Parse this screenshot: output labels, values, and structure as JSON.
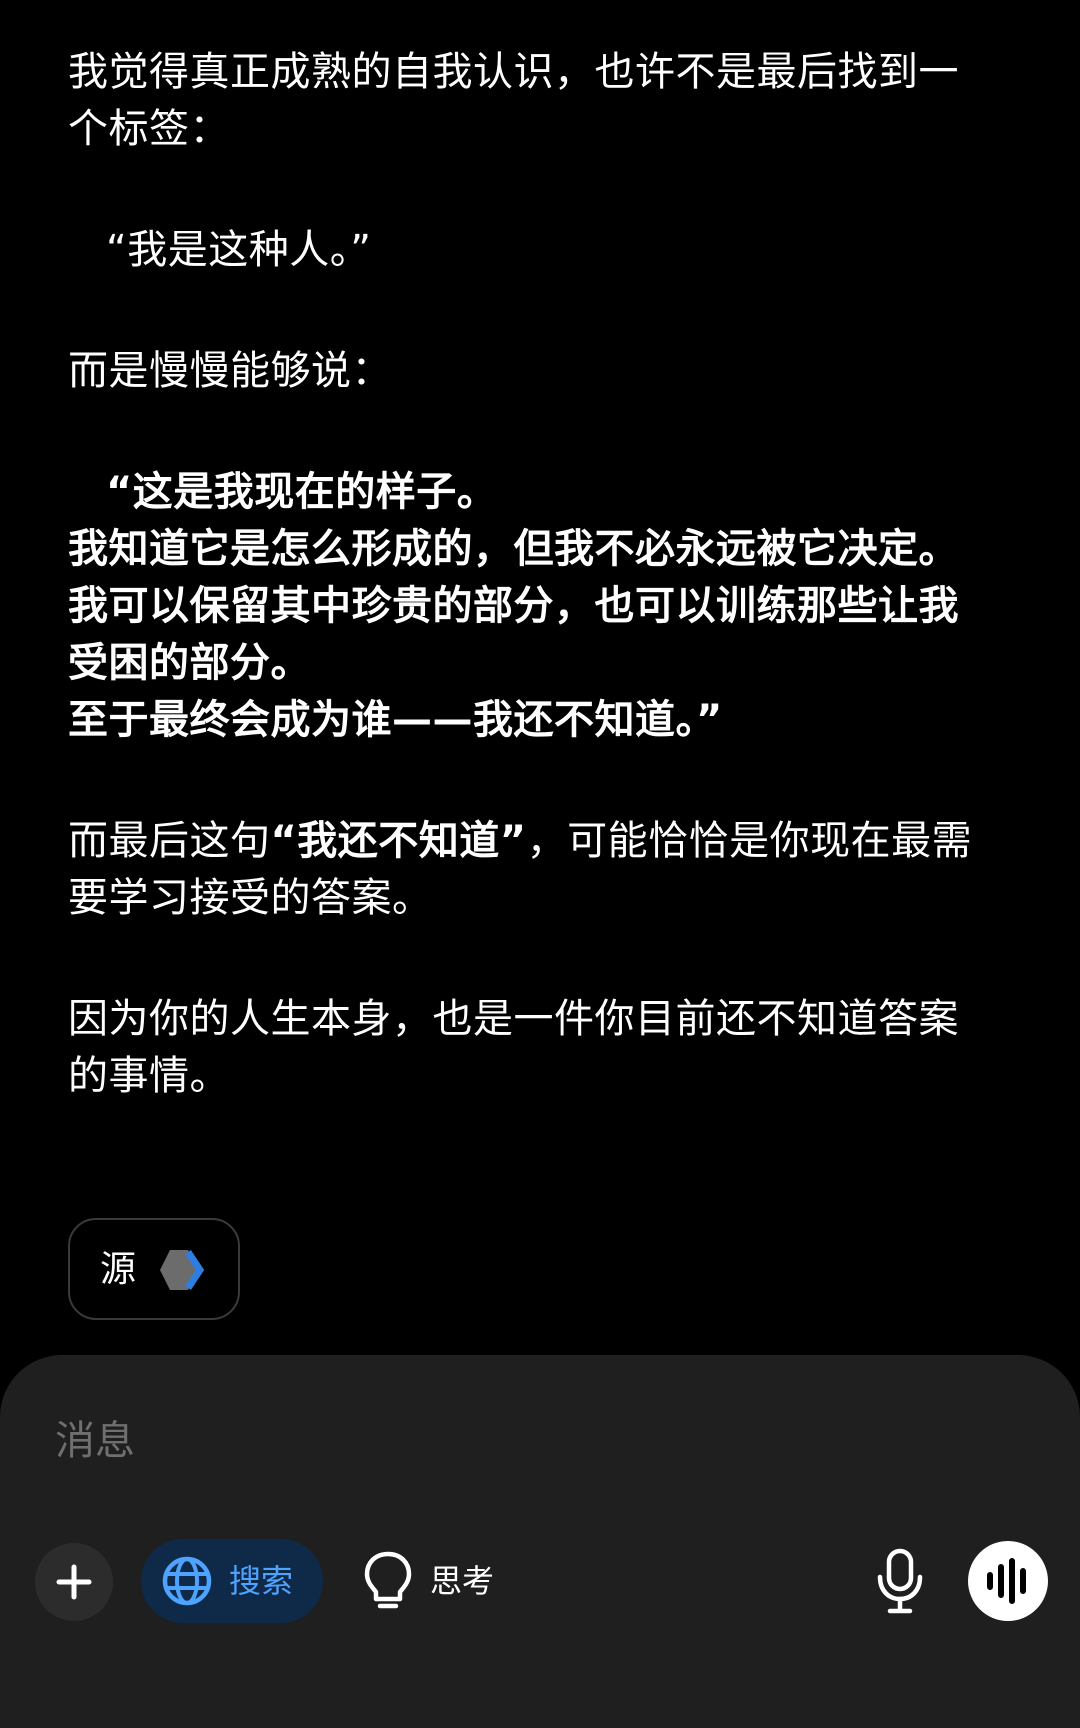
{
  "message": {
    "paragraphs": [
      "我觉得真正成熟的自我认识，也许不是最后找到一个标签：",
      "“我是这种人。”",
      "而是慢慢能够说："
    ],
    "quote_lines": [
      "“这是我现在的样子。",
      "我知道它是怎么形成的，但我不必永远被它决定。",
      "我可以保留其中珍贵的部分，也可以训练那些让我受困的部分。",
      "至于最终会成为谁——我还不知道。”"
    ],
    "para_after_quote": {
      "prefix": "而最后这句",
      "bold_text": "“我还不知道”",
      "suffix": "，可能恰恰是你现在最需要学习接受的答案。"
    },
    "closing": "因为你的人生本身，也是一件你目前还不知道答案的事情。"
  },
  "source_chip": {
    "label": "源",
    "icon": "chevron-right-icon"
  },
  "composer": {
    "placeholder": "消息",
    "buttons": {
      "plus_icon": "plus-icon",
      "search_label": "搜索",
      "search_icon": "globe-icon",
      "think_label": "思考",
      "think_icon": "lightbulb-icon",
      "mic_icon": "microphone-icon",
      "voice_icon": "voice-waveform-icon"
    }
  },
  "colors": {
    "background": "#000000",
    "composer_bg": "#1f1f1f",
    "accent_blue": "#4ea3ff",
    "search_pill_bg": "#0f2a48",
    "placeholder": "#6f6f6f"
  }
}
